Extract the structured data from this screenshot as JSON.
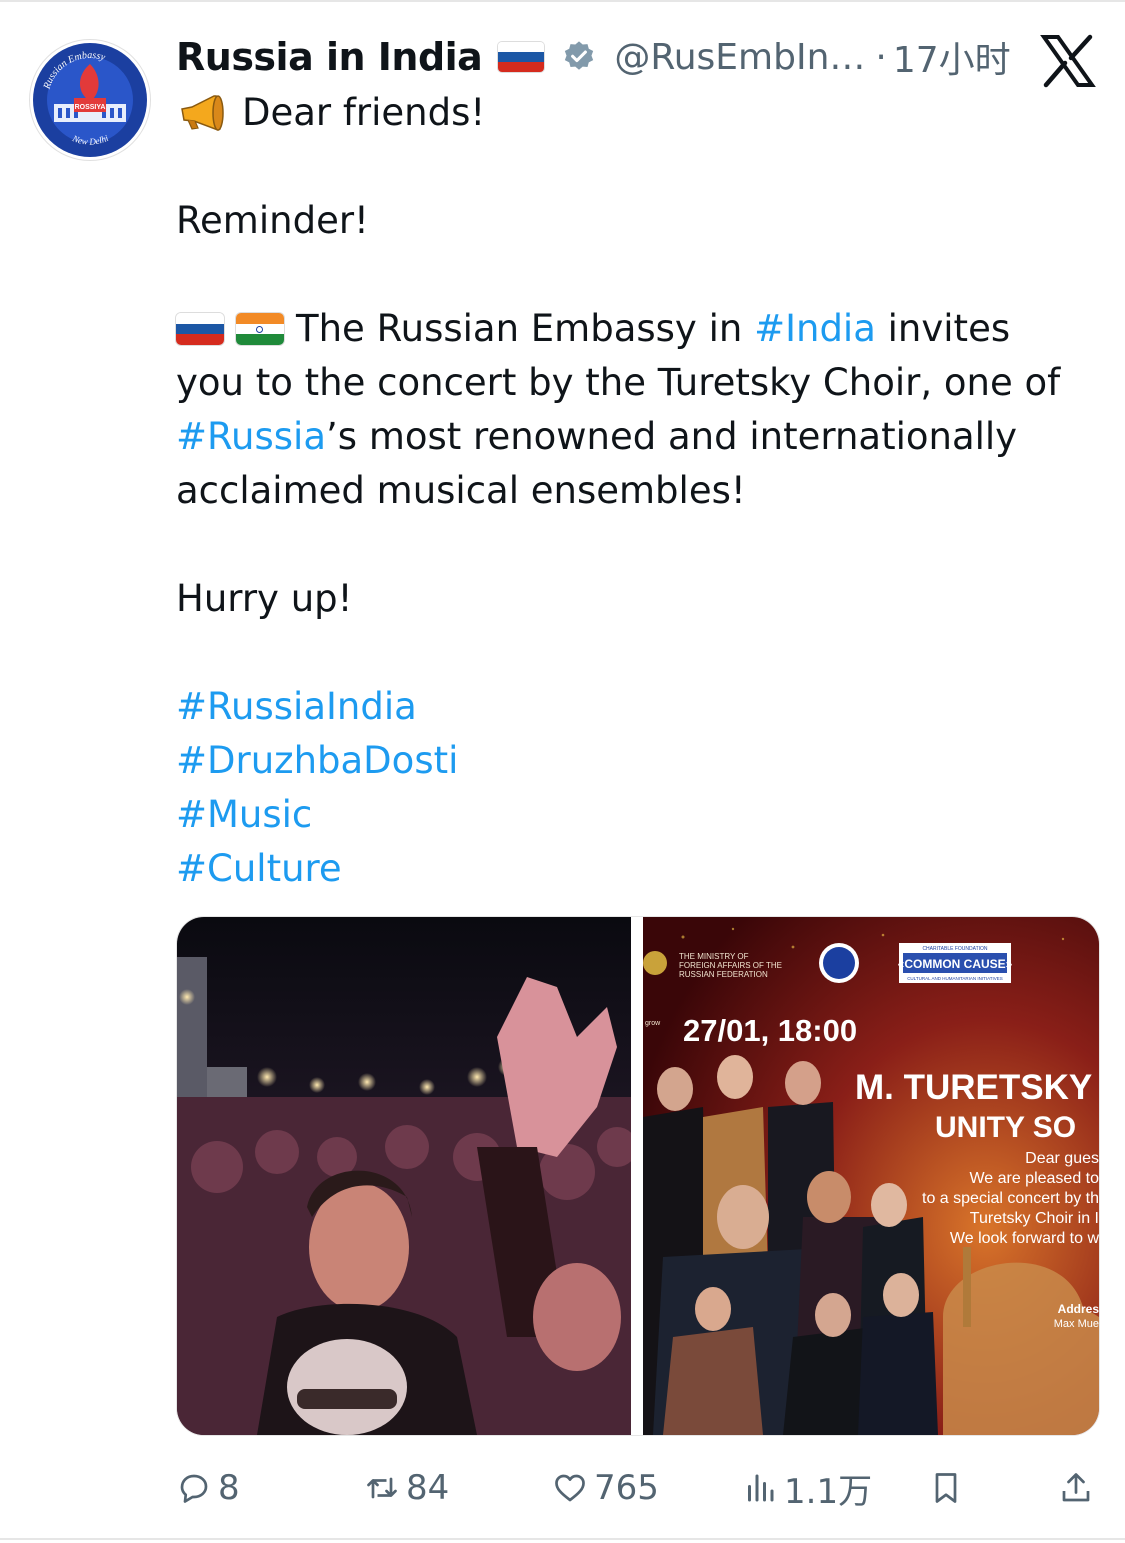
{
  "header": {
    "display_name": "Russia in India",
    "handle": "@RusEmbIn…",
    "separator": "·",
    "time": "17小时",
    "verified_icon": "verified-badge-icon",
    "name_flag": "russia-flag"
  },
  "avatar": {
    "top_text": "Russian Embassy",
    "bottom_text": "New Delhi",
    "badge_text": "ROSSIYA"
  },
  "tweet": {
    "greeting": "Dear friends!",
    "reminder": "Reminder!",
    "body_1": "The Russian Embassy in ",
    "hashtag_india": "#India",
    "body_2": " invites",
    "line_2": "you to the concert by the Turetsky Choir, one of",
    "hashtag_russia": "#Russia",
    "line_3_rest": "’s most renowned and internationally",
    "line_4": "acclaimed musical ensembles!",
    "hurry": "Hurry up!",
    "hashtags": [
      "#RussiaIndia",
      "#DruzhbaDosti",
      "#Music",
      "#Culture"
    ]
  },
  "poster": {
    "ministry": [
      "THE MINISTRY OF",
      "FOREIGN AFFAIRS OF THE",
      "RUSSIAN FEDERATION"
    ],
    "foundation_top": "CHARITABLE    FOUNDATION",
    "foundation_name": "«COMMON CAUSE»",
    "foundation_sub": "CULTURAL AND HUMANITARIAN INITIATIVES",
    "date": "27/01, 18:00",
    "title": "M. TURETSKY CHO",
    "subtitle": "UNITY SO",
    "lines": [
      "Dear gues",
      "We are pleased to",
      "to a special concert by th",
      "Turetsky Choir in I",
      "We look forward to w"
    ],
    "address_label": "Addres",
    "address_line": "Max Mue",
    "side_label": "grow"
  },
  "actions": {
    "replies": "8",
    "reposts": "84",
    "likes": "765",
    "views": "1.1万"
  },
  "colors": {
    "link": "#1d9bf0",
    "muted": "#536471",
    "text": "#0f1419"
  }
}
